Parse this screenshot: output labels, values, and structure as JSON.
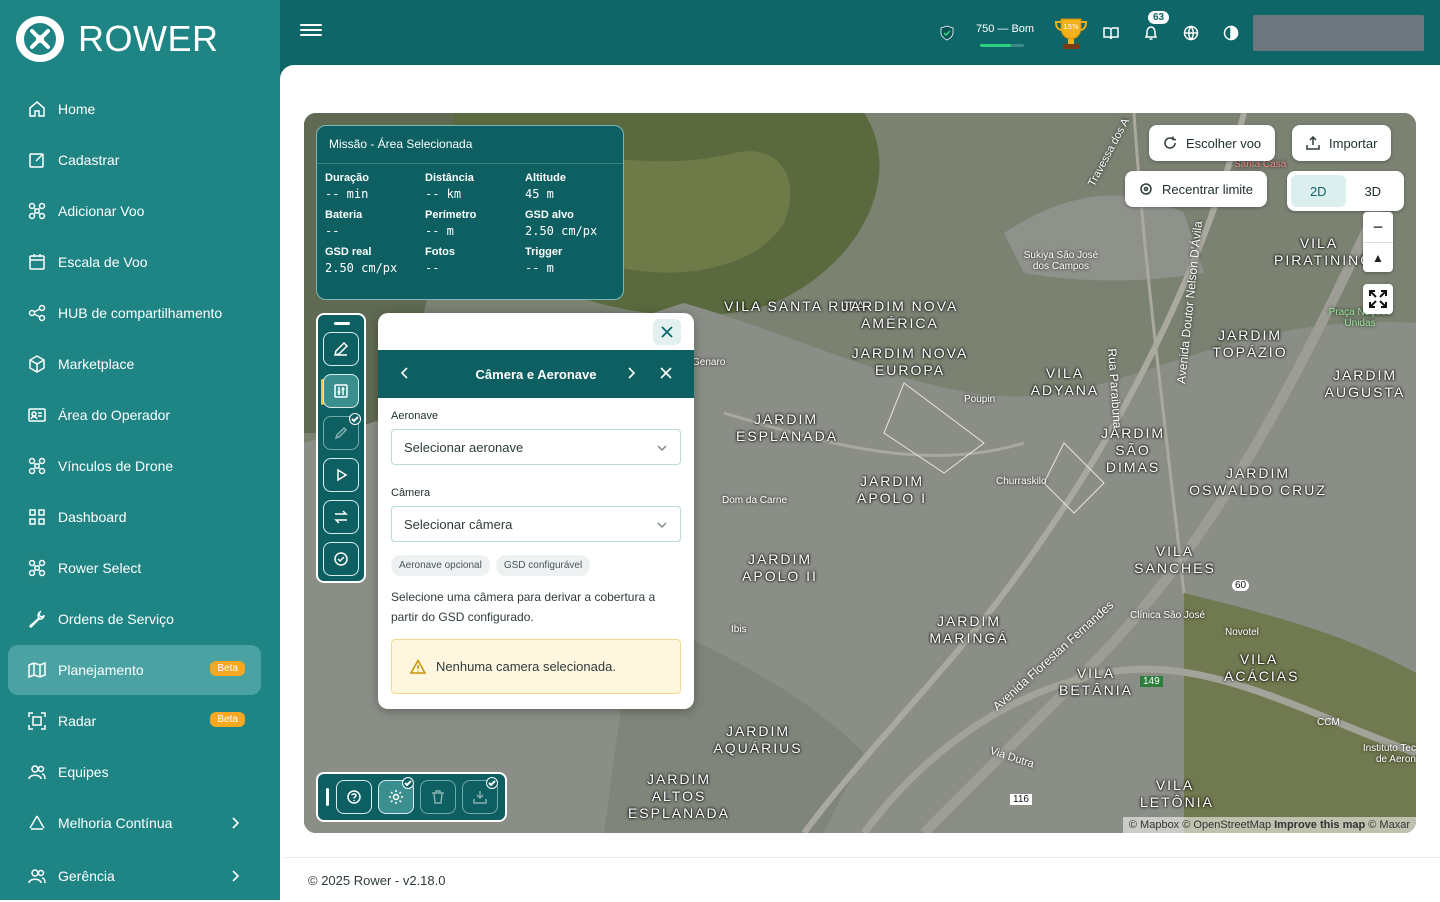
{
  "brand": {
    "name": "ROWER",
    "logo_icon": "drone-logo-icon"
  },
  "sidebar": {
    "items": [
      {
        "label": "Home",
        "icon": "home-icon"
      },
      {
        "label": "Cadastrar",
        "icon": "edit-square-icon"
      },
      {
        "label": "Adicionar Voo",
        "icon": "drone-icon"
      },
      {
        "label": "Escala de Voo",
        "icon": "calendar-icon"
      },
      {
        "label": "HUB de compartilhamento",
        "icon": "share-icon"
      },
      {
        "label": "Marketplace",
        "icon": "box-icon"
      },
      {
        "label": "Área do Operador",
        "icon": "id-card-icon"
      },
      {
        "label": "Vínculos de Drone",
        "icon": "drone-icon"
      },
      {
        "label": "Dashboard",
        "icon": "grid-icon"
      },
      {
        "label": "Rower Select",
        "icon": "drone-icon"
      },
      {
        "label": "Ordens de Serviço",
        "icon": "wrench-icon"
      },
      {
        "label": "Planejamento",
        "icon": "map-icon",
        "badge": "Beta",
        "active": true
      },
      {
        "label": "Radar",
        "icon": "scan-icon",
        "badge": "Beta"
      },
      {
        "label": "Equipes",
        "icon": "users-icon"
      },
      {
        "label": "Melhoria Contínua",
        "icon": "recycle-icon",
        "chevron": true
      },
      {
        "label": "Gerência",
        "icon": "users-icon",
        "chevron": true
      }
    ]
  },
  "header": {
    "score_text": "750 — Bom",
    "score_progress": 0.7,
    "trophy_text": "15%",
    "notifications_count": "63",
    "accent": "#0e6668"
  },
  "mission": {
    "title": "Missão - Área Selecionada",
    "stats": [
      {
        "label": "Duração",
        "value": "-- min"
      },
      {
        "label": "Distância",
        "value": "-- km"
      },
      {
        "label": "Altitude",
        "value": "45 m"
      },
      {
        "label": "Bateria",
        "value": "--"
      },
      {
        "label": "Perímetro",
        "value": "-- m"
      },
      {
        "label": "GSD alvo",
        "value": "2.50 cm/px"
      },
      {
        "label": "GSD real",
        "value": "2.50 cm/px"
      },
      {
        "label": "Fotos",
        "value": "--"
      },
      {
        "label": "Trigger",
        "value": "-- m"
      }
    ]
  },
  "camera_panel": {
    "title": "Câmera e Aeronave",
    "aircraft_label": "Aeronave",
    "aircraft_value": "Selecionar aeronave",
    "camera_label": "Câmera",
    "camera_value": "Selecionar câmera",
    "chips": [
      "Aeronave opcional",
      "GSD configurável"
    ],
    "description": "Selecione uma câmera para derivar a cobertura a partir do GSD configurado.",
    "warning": "Nenhuma camera selecionada."
  },
  "map_controls": {
    "choose_flight": "Escolher voo",
    "import": "Importar",
    "recenter": "Recentrar limite",
    "view_2d": "2D",
    "view_3d": "3D",
    "zoom_out": "−",
    "compass": "▲"
  },
  "map": {
    "neighborhoods": [
      "VILA SANTA RITA",
      "JARDIM NOVA AMÉRICA",
      "JARDIM NOVA EUROPA",
      "VILA ADYANA",
      "JARDIM TOPÁZIO",
      "JARDIM AUGUSTA",
      "JARDIM ESPLANADA",
      "JARDIM SÃO DIMAS",
      "JARDIM APOLO I",
      "JARDIM OSWALDO CRUZ",
      "JARDIM APOLO II",
      "VILA SANCHES",
      "JARDIM MARINGÁ",
      "VILA BETÂNIA",
      "VILA ACÁCIAS",
      "JARDIM AQUÁRIUS",
      "JARDIM ALTOS ESPLANADA",
      "VILA LETÔNIA",
      "VILA PIRATININGA"
    ],
    "pois": [
      "Sukiya São José dos Campos",
      "Poupin",
      "Churraskilo",
      "Dom da Carne",
      "Clínica São José",
      "Novotel",
      "Ibis",
      "CCM",
      "Instituto Tec de Aeron",
      "Genaro",
      "Praça Nações Unidas",
      "Santa Casa"
    ],
    "roads": [
      "Rua Paraibuna",
      "Avenida Doutor Nelson D'Ávila",
      "Avenida Florestan Fernandes",
      "Travessa dos A",
      "Via Dutra"
    ],
    "shields": [
      "60",
      "149",
      "116"
    ],
    "attribution": "© Mapbox © OpenStreetMap",
    "improve": "Improve this map",
    "maxar": "© Maxar"
  },
  "footer": {
    "text": "© 2025 Rower - v2.18.0"
  }
}
